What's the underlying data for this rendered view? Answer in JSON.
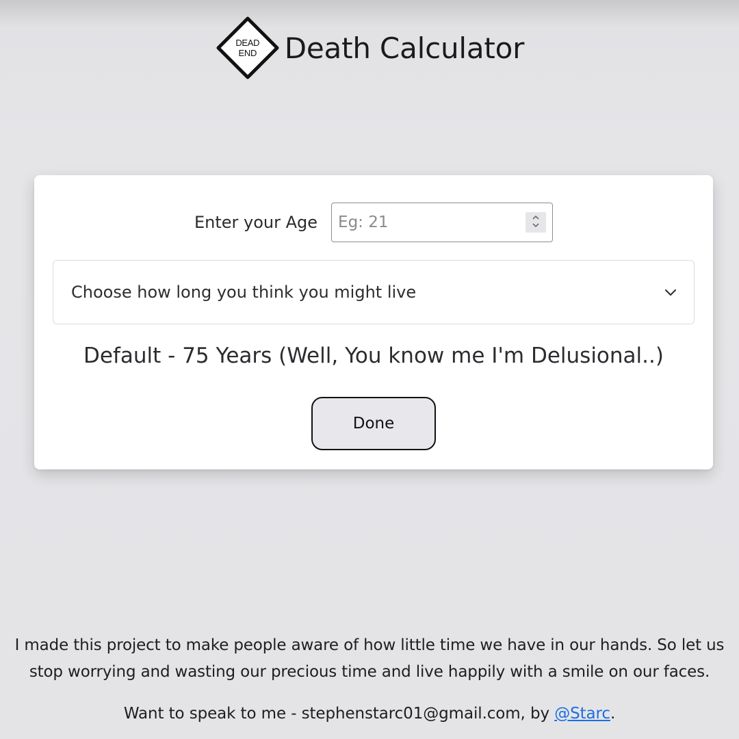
{
  "header": {
    "logo_line1": "DEAD",
    "logo_line2": "END",
    "title": "Death Calculator"
  },
  "form": {
    "age_label": "Enter your Age",
    "age_placeholder": "Eg: 21",
    "lifespan_select": "Choose how long you think you might live",
    "default_text": "Default - 75 Years (Well, You know me I'm Delusional..)",
    "done_label": "Done"
  },
  "footer": {
    "message": "I made this project to make people aware of how little time we have in our hands. So let us stop worrying and wasting our precious time and live happily with a smile on our faces.",
    "contact_prefix": "Want to speak to me - stephenstarc01@gmail.com, by ",
    "contact_link": "@Starc",
    "contact_suffix": "."
  },
  "colors": {
    "background": "#e4e4e7",
    "card": "#ffffff",
    "link": "#1a6fe0",
    "button": "#e8e8ec"
  },
  "icons": {
    "logo": "dead-end-sign-icon",
    "spinner_up": "chevron-up-icon",
    "spinner_down": "chevron-down-icon",
    "select": "chevron-down-icon"
  }
}
